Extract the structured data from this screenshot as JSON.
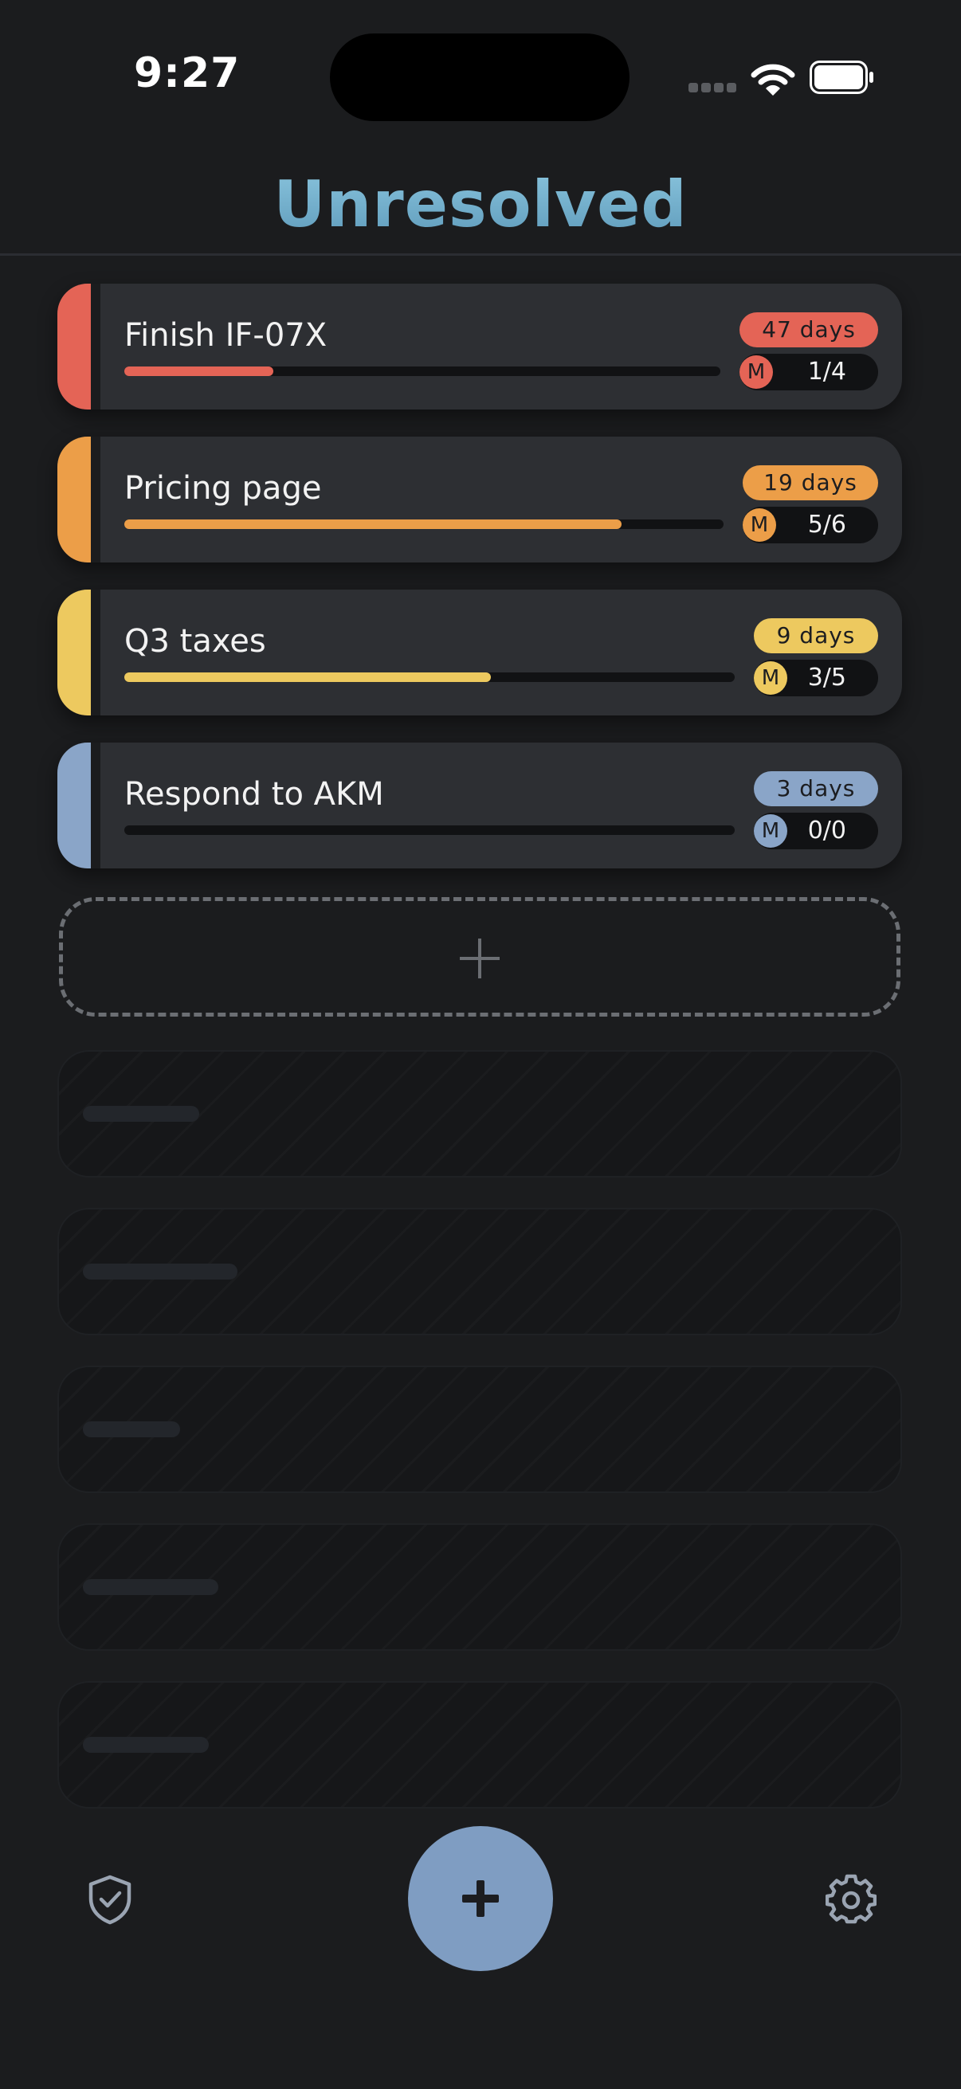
{
  "status_bar": {
    "time": "9:27"
  },
  "header": {
    "title": "Unresolved"
  },
  "colors": {
    "red": "#e46456",
    "orange": "#ec9e48",
    "yellow": "#edc95f",
    "blue": "#8aa5c8",
    "fab": "#7f9dc2",
    "background": "#1b1c1e",
    "card": "#2d2f33"
  },
  "tasks": [
    {
      "title": "Finish IF-07X",
      "days": "47 days",
      "assignee": "M",
      "count": "1/4",
      "progress": 0.25,
      "color": "#e46456"
    },
    {
      "title": "Pricing page",
      "days": "19 days",
      "assignee": "M",
      "count": "5/6",
      "progress": 0.83,
      "color": "#ec9e48"
    },
    {
      "title": "Q3 taxes",
      "days": "9 days",
      "assignee": "M",
      "count": "3/5",
      "progress": 0.6,
      "color": "#edc95f"
    },
    {
      "title": "Respond to AKM",
      "days": "3 days",
      "assignee": "M",
      "count": "0/0",
      "progress": 0,
      "color": "#8aa5c8"
    }
  ],
  "add_slot": {
    "icon": "plus-icon"
  },
  "bottom_bar": {
    "left_icon": "shield-check-icon",
    "fab_icon": "plus-icon",
    "right_icon": "gear-icon"
  }
}
